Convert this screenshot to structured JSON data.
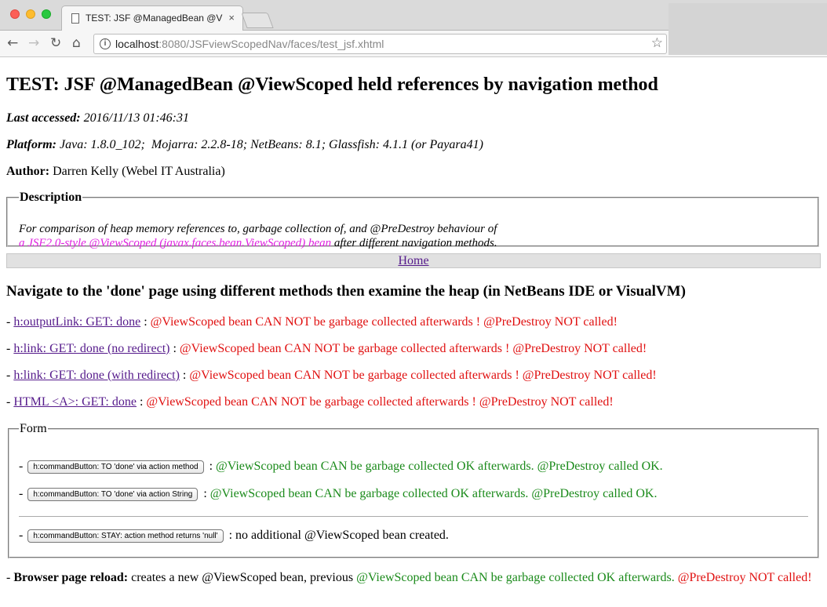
{
  "browser": {
    "tab_title": "TEST: JSF @ManagedBean @ViewScoped held references by navigation method",
    "tab_close": "×",
    "url_host": "localhost",
    "url_rest": ":8080/JSFviewScopedNav/faces/test_jsf.xhtml",
    "icons": [
      "back-arrow-icon",
      "forward-arrow-icon",
      "reload-icon",
      "home-icon",
      "info-icon",
      "star-icon",
      "page-icon"
    ]
  },
  "page": {
    "title": "TEST: JSF @ManagedBean @ViewScoped held references by navigation method",
    "last_accessed_label": "Last accessed:",
    "last_accessed_value": "2016/11/13 01:46:31",
    "platform_label": "Platform:",
    "platform_value": "Java: 1.8.0_102;  Mojarra: 2.2.8-18; NetBeans: 8.1; Glassfish: 4.1.1 (or Payara41)",
    "author_label": "Author:",
    "author_value": "Darren Kelly (Webel IT Australia)",
    "description": {
      "legend": "Description",
      "text1": "For comparison of heap memory references to, garbage collection of, and @PreDestroy behaviour of",
      "text_magenta": "a JSF2.0-style @ViewScoped (javax.faces.bean.ViewScoped) bean",
      "text2": " after different navigation methods."
    },
    "home_link": "Home",
    "nav_heading": "Navigate to the 'done' page using different methods then examine the heap (in NetBeans IDE or VisualVM)",
    "nav_items": [
      {
        "link": "h:outputLink: GET: done",
        "result": "@ViewScoped bean CAN NOT be garbage collected afterwards ! @PreDestroy NOT called!"
      },
      {
        "link": "h:link: GET: done (no redirect)",
        "result": "@ViewScoped bean CAN NOT be garbage collected afterwards ! @PreDestroy NOT called!"
      },
      {
        "link": "h:link: GET: done (with redirect)",
        "result": "@ViewScoped bean CAN NOT be garbage collected afterwards ! @PreDestroy NOT called!"
      },
      {
        "link": "HTML <A>: GET: done",
        "result": "@ViewScoped bean CAN NOT be garbage collected afterwards ! @PreDestroy NOT called!"
      }
    ],
    "form": {
      "legend": "Form",
      "buttons": [
        {
          "label": "h:commandButton: TO 'done' via action method",
          "result": "@ViewScoped bean CAN be garbage collected OK afterwards. @PreDestroy called OK."
        },
        {
          "label": "h:commandButton: TO 'done' via action String",
          "result": "@ViewScoped bean CAN be garbage collected OK afterwards. @PreDestroy called OK."
        },
        {
          "label": "h:commandButton: STAY: action method returns 'null'",
          "result": "no additional @ViewScoped bean created."
        }
      ]
    },
    "reload": {
      "label": "Browser page reload:",
      "text": " creates a new @ViewScoped bean, previous ",
      "green": "@ViewScoped bean CAN be garbage collected OK afterwards.",
      "red": "@PreDestroy NOT called!"
    },
    "colors": {
      "link": "#551a8b",
      "fail": "#e01010",
      "ok": "#1a8a1a",
      "highlight": "#e020e0"
    }
  }
}
